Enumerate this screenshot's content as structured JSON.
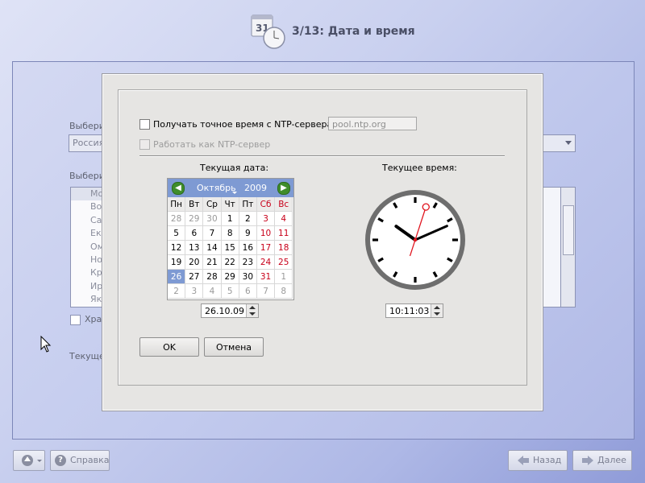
{
  "header": {
    "title": "3/13: Дата и время",
    "calendar_icon_day": "31"
  },
  "background": {
    "label_select_top": "Выбери",
    "combo_value": "Россия",
    "label_select_list": "Выбери",
    "list_items": [
      "Мо",
      "Во",
      "Са",
      "Ек",
      "Ом",
      "Но",
      "Кр",
      "Ир",
      "Як"
    ],
    "checkbox_label": "Хра",
    "current_label": "Текуще"
  },
  "dialog": {
    "ntp_checkbox_label": "Получать точное время с NTP-сервера:",
    "ntp_server_placeholder": "pool.ntp.org",
    "ntp_server_mode_label": "Работать как NTP-сервер",
    "date_title": "Текущая дата:",
    "time_title": "Текущее время:",
    "calendar": {
      "month": "Октябрь",
      "year": "2009",
      "weekday_headers": [
        "Пн",
        "Вт",
        "Ср",
        "Чт",
        "Пт",
        "Сб",
        "Вс"
      ],
      "rows": [
        [
          "28",
          "29",
          "30",
          "1",
          "2",
          "3",
          "4"
        ],
        [
          "5",
          "6",
          "7",
          "8",
          "9",
          "10",
          "11"
        ],
        [
          "12",
          "13",
          "14",
          "15",
          "16",
          "17",
          "18"
        ],
        [
          "19",
          "20",
          "21",
          "22",
          "23",
          "24",
          "25"
        ],
        [
          "26",
          "27",
          "28",
          "29",
          "30",
          "31",
          "1"
        ],
        [
          "2",
          "3",
          "4",
          "5",
          "6",
          "7",
          "8"
        ]
      ],
      "selected": "26"
    },
    "date_value": "26.10.09",
    "time_value": "10:11:03",
    "clock": {
      "hours": 10,
      "minutes": 11,
      "seconds": 3
    },
    "ok_label": "OK",
    "cancel_label": "Отмена"
  },
  "footer": {
    "help_label": "Справка",
    "back_label": "Назад",
    "next_label": "Далее"
  },
  "colors": {
    "calendar_accent": "#7e9ad3",
    "weekend": "#c8001a",
    "nav_green": "#3f8d2b",
    "second_hand": "#e0141e"
  }
}
